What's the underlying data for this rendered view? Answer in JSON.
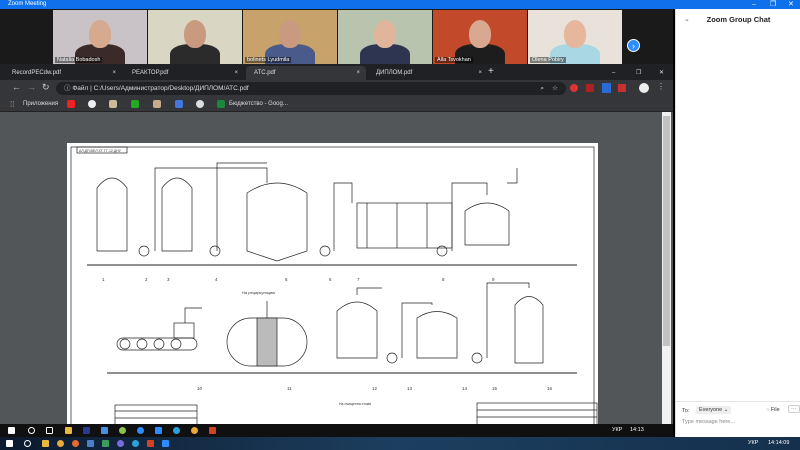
{
  "zoom": {
    "title": "Zoom Meeting",
    "minimize": "–",
    "restore": "❐",
    "close": "✕"
  },
  "participants": [
    {
      "name": "Natalia Bobadosh",
      "bg": "#c9c3c8",
      "skin": "#d7a98e",
      "shirt": "#3a2a2a"
    },
    {
      "name": "",
      "bg": "#d9d7c4",
      "skin": "#c99a80",
      "shirt": "#2b2b2b"
    },
    {
      "name": "bolinets Lyudmila",
      "bg": "#c7a26a",
      "skin": "#c99a80",
      "shirt": "#4a5a8a"
    },
    {
      "name": "",
      "bg": "#b8c4ad",
      "skin": "#e1b59b",
      "shirt": "#2d3550"
    },
    {
      "name": "Alla Tsvokhan",
      "bg": "#c24a2a",
      "skin": "#d8a890",
      "shirt": "#1d1d1d"
    },
    {
      "name": "Olena Pobiry",
      "bg": "#e8e2da",
      "skin": "#e6b79d",
      "shirt": "#a9d8e4"
    }
  ],
  "browser": {
    "tabs": [
      {
        "label": "RecordРЕСdw.pdf",
        "close": "×",
        "active": false
      },
      {
        "label": "РЕАКТОР.pdf",
        "close": "×",
        "active": false
      },
      {
        "label": "АТС.pdf",
        "close": "×",
        "active": true
      },
      {
        "label": "ДИПЛОМ.pdf",
        "close": "×",
        "active": false
      }
    ],
    "new_tab": "+",
    "win": {
      "min": "–",
      "max": "❐",
      "close": "✕"
    },
    "nav": {
      "back": "←",
      "forward": "→",
      "reload": "↻"
    },
    "address_label": "Файл",
    "address": "C:/Users/Администратор/Desktop/ДИПЛОМ/АТС.pdf",
    "bookmarks": {
      "apps": "Приложения",
      "last": "Бюджетство - Goog..."
    }
  },
  "drawing": {
    "stamp": "АЛ.ДП.ВЕЛ.ХТ.ТТ-12.ДНУ",
    "note1": "На рециркуляцию",
    "note2": "На очищення стоків",
    "labels": [
      "1",
      "2",
      "3",
      "4",
      "5",
      "6",
      "7",
      "8",
      "9",
      "10",
      "11",
      "12",
      "13",
      "14",
      "15",
      "16"
    ]
  },
  "inner_taskbar": {
    "lang": "УКР",
    "time": "14:13"
  },
  "chat": {
    "title": "Zoom Group Chat",
    "collapse": "⌄",
    "to_label": "To:",
    "to_value": "Everyone",
    "file": "File",
    "more": "···",
    "placeholder": "Type message here..."
  },
  "outer_taskbar": {
    "lang": "УКР",
    "time": "14:14:09"
  },
  "colors": {
    "zoom_blue": "#0e71eb",
    "chrome_dark": "#202124",
    "pdf_bg": "#525659"
  }
}
